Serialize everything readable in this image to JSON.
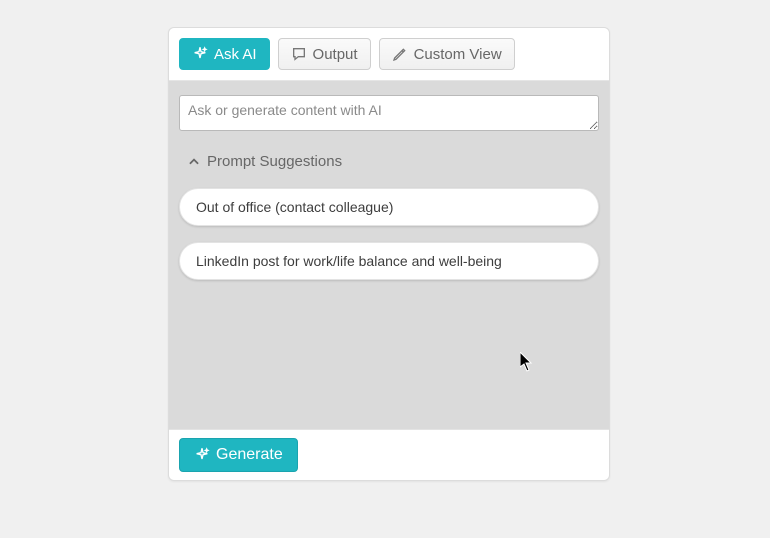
{
  "tabs": {
    "ask_ai": "Ask AI",
    "output": "Output",
    "custom_view": "Custom View"
  },
  "prompt": {
    "value": "",
    "placeholder": "Ask or generate content with AI"
  },
  "suggestions": {
    "header": "Prompt Suggestions",
    "items": [
      "Out of office (contact colleague)",
      "LinkedIn post for work/life balance and well-being"
    ]
  },
  "footer": {
    "generate": "Generate"
  },
  "colors": {
    "accent": "#1fb6c1",
    "panel_bg": "#dadada"
  }
}
